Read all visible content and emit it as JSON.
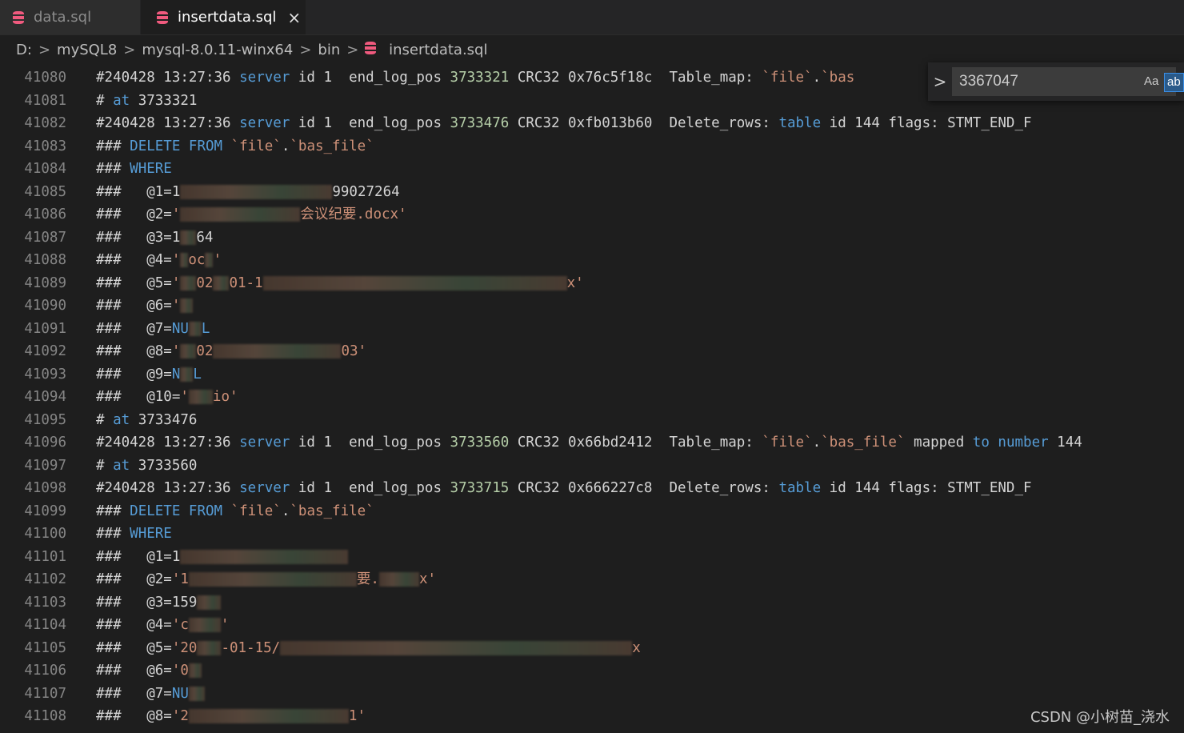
{
  "tabs": [
    {
      "label": "data.sql",
      "active": false
    },
    {
      "label": "insertdata.sql",
      "active": true,
      "close_icon": "×"
    }
  ],
  "breadcrumb": {
    "items": [
      "D:",
      "mySQL8",
      "mysql-8.0.11-winx64",
      "bin",
      "insertdata.sql"
    ],
    "separator": ">"
  },
  "find": {
    "value": "3367047",
    "toggle_icon": ">",
    "match_case_label": "Aa",
    "whole_word_label": "ab"
  },
  "lines": [
    {
      "n": "41080",
      "t": [
        [
          "p",
          "#240428 13:27:36 "
        ],
        [
          "k",
          "server"
        ],
        [
          "p",
          " id 1  end_log_pos "
        ],
        [
          "u",
          "3733321"
        ],
        [
          "p",
          " CRC32 0x76c5f18c  Table_map: "
        ],
        [
          "s",
          "`file`"
        ],
        [
          "p",
          "."
        ],
        [
          "s",
          "`bas"
        ]
      ]
    },
    {
      "n": "41081",
      "t": [
        [
          "p",
          "# "
        ],
        [
          "k",
          "at"
        ],
        [
          "p",
          " 3733321"
        ]
      ]
    },
    {
      "n": "41082",
      "t": [
        [
          "p",
          "#240428 13:27:36 "
        ],
        [
          "k",
          "server"
        ],
        [
          "p",
          " id 1  end_log_pos "
        ],
        [
          "u",
          "3733476"
        ],
        [
          "p",
          " CRC32 0xfb013b60  Delete_rows: "
        ],
        [
          "k",
          "table"
        ],
        [
          "p",
          " id 144 flags: STMT_END_F"
        ]
      ]
    },
    {
      "n": "41083",
      "t": [
        [
          "p",
          "### "
        ],
        [
          "k",
          "DELETE FROM"
        ],
        [
          "p",
          " "
        ],
        [
          "s",
          "`file`"
        ],
        [
          "p",
          "."
        ],
        [
          "s",
          "`bas_file`"
        ]
      ]
    },
    {
      "n": "41084",
      "t": [
        [
          "p",
          "### "
        ],
        [
          "k",
          "WHERE"
        ]
      ]
    },
    {
      "n": "41085",
      "t": [
        [
          "p",
          "###   @1=1"
        ],
        [
          "b",
          "190"
        ],
        [
          "p",
          "99027264"
        ]
      ]
    },
    {
      "n": "41086",
      "t": [
        [
          "p",
          "###   @2="
        ],
        [
          "s",
          "'"
        ],
        [
          "b",
          "150"
        ],
        [
          "s",
          "会议纪要.docx'"
        ]
      ]
    },
    {
      "n": "41087",
      "t": [
        [
          "p",
          "###   @3=1"
        ],
        [
          "b",
          "20"
        ],
        [
          "p",
          "64"
        ]
      ]
    },
    {
      "n": "41088",
      "t": [
        [
          "p",
          "###   @4="
        ],
        [
          "s",
          "'"
        ],
        [
          "b",
          "10"
        ],
        [
          "s",
          "oc"
        ],
        [
          "b",
          "10"
        ],
        [
          "s",
          "'"
        ]
      ]
    },
    {
      "n": "41089",
      "t": [
        [
          "p",
          "###   @5="
        ],
        [
          "s",
          "'"
        ],
        [
          "b",
          "20"
        ],
        [
          "s",
          "02"
        ],
        [
          "b",
          "20"
        ],
        [
          "s",
          "01-1"
        ],
        [
          "b",
          "380"
        ],
        [
          "s",
          "x'"
        ]
      ]
    },
    {
      "n": "41090",
      "t": [
        [
          "p",
          "###   @6="
        ],
        [
          "s",
          "'"
        ],
        [
          "b",
          "16"
        ]
      ]
    },
    {
      "n": "41091",
      "t": [
        [
          "p",
          "###   @7="
        ],
        [
          "k",
          "NU"
        ],
        [
          "b",
          "16"
        ],
        [
          "k",
          "L"
        ]
      ]
    },
    {
      "n": "41092",
      "t": [
        [
          "p",
          "###   @8="
        ],
        [
          "s",
          "'"
        ],
        [
          "b",
          "20"
        ],
        [
          "s",
          "02"
        ],
        [
          "b",
          "160"
        ],
        [
          "s",
          "03'"
        ]
      ]
    },
    {
      "n": "41093",
      "t": [
        [
          "p",
          "###   @9="
        ],
        [
          "k",
          "N"
        ],
        [
          "b",
          "16"
        ],
        [
          "k",
          "L"
        ]
      ]
    },
    {
      "n": "41094",
      "t": [
        [
          "p",
          "###   @10="
        ],
        [
          "s",
          "'"
        ],
        [
          "b",
          "30"
        ],
        [
          "s",
          "io'"
        ]
      ]
    },
    {
      "n": "41095",
      "t": [
        [
          "p",
          "# "
        ],
        [
          "k",
          "at"
        ],
        [
          "p",
          " 3733476"
        ]
      ]
    },
    {
      "n": "41096",
      "t": [
        [
          "p",
          "#240428 13:27:36 "
        ],
        [
          "k",
          "server"
        ],
        [
          "p",
          " id 1  end_log_pos "
        ],
        [
          "u",
          "3733560"
        ],
        [
          "p",
          " CRC32 0x66bd2412  Table_map: "
        ],
        [
          "s",
          "`file`"
        ],
        [
          "p",
          "."
        ],
        [
          "s",
          "`bas_file`"
        ],
        [
          "p",
          " mapped "
        ],
        [
          "k",
          "to"
        ],
        [
          "p",
          " "
        ],
        [
          "k",
          "number"
        ],
        [
          "p",
          " 144"
        ]
      ]
    },
    {
      "n": "41097",
      "t": [
        [
          "p",
          "# "
        ],
        [
          "k",
          "at"
        ],
        [
          "p",
          " 3733560"
        ]
      ]
    },
    {
      "n": "41098",
      "t": [
        [
          "p",
          "#240428 13:27:36 "
        ],
        [
          "k",
          "server"
        ],
        [
          "p",
          " id 1  end_log_pos "
        ],
        [
          "u",
          "3733715"
        ],
        [
          "p",
          " CRC32 0x666227c8  Delete_rows: "
        ],
        [
          "k",
          "table"
        ],
        [
          "p",
          " id 144 flags: STMT_END_F"
        ]
      ]
    },
    {
      "n": "41099",
      "t": [
        [
          "p",
          "### "
        ],
        [
          "k",
          "DELETE FROM"
        ],
        [
          "p",
          " "
        ],
        [
          "s",
          "`file`"
        ],
        [
          "p",
          "."
        ],
        [
          "s",
          "`bas_file`"
        ]
      ]
    },
    {
      "n": "41100",
      "t": [
        [
          "p",
          "### "
        ],
        [
          "k",
          "WHERE"
        ]
      ]
    },
    {
      "n": "41101",
      "t": [
        [
          "p",
          "###   @1=1"
        ],
        [
          "b",
          "210"
        ]
      ]
    },
    {
      "n": "41102",
      "t": [
        [
          "p",
          "###   @2="
        ],
        [
          "s",
          "'1"
        ],
        [
          "b",
          "210"
        ],
        [
          "s",
          "要."
        ],
        [
          "b",
          "50"
        ],
        [
          "s",
          "x'"
        ]
      ]
    },
    {
      "n": "41103",
      "t": [
        [
          "p",
          "###   @3=159"
        ],
        [
          "b",
          "30"
        ]
      ]
    },
    {
      "n": "41104",
      "t": [
        [
          "p",
          "###   @4="
        ],
        [
          "s",
          "'c"
        ],
        [
          "b",
          "40"
        ],
        [
          "s",
          "'"
        ]
      ]
    },
    {
      "n": "41105",
      "t": [
        [
          "p",
          "###   @5="
        ],
        [
          "s",
          "'20"
        ],
        [
          "b",
          "30"
        ],
        [
          "s",
          "-01-15/"
        ],
        [
          "b",
          "440"
        ],
        [
          "s",
          "x"
        ]
      ]
    },
    {
      "n": "41106",
      "t": [
        [
          "p",
          "###   @6="
        ],
        [
          "s",
          "'0"
        ],
        [
          "b",
          "16"
        ]
      ]
    },
    {
      "n": "41107",
      "t": [
        [
          "p",
          "###   @7="
        ],
        [
          "k",
          "NU"
        ],
        [
          "b",
          "20"
        ]
      ]
    },
    {
      "n": "41108",
      "t": [
        [
          "p",
          "###   @8="
        ],
        [
          "s",
          "'2"
        ],
        [
          "b",
          "200"
        ],
        [
          "s",
          "1'"
        ]
      ]
    }
  ],
  "watermark": "CSDN @小树苗_浇水",
  "colors": {
    "keyword": "#569cd6",
    "number": "#b5cea8",
    "string": "#ce9178",
    "text": "#d4d4d4",
    "line_number": "#858585",
    "background": "#1e1e1e"
  },
  "icons": [
    "database-file-icon",
    "close-icon",
    "chevron-right-icon",
    "match-case-icon",
    "whole-word-icon"
  ]
}
